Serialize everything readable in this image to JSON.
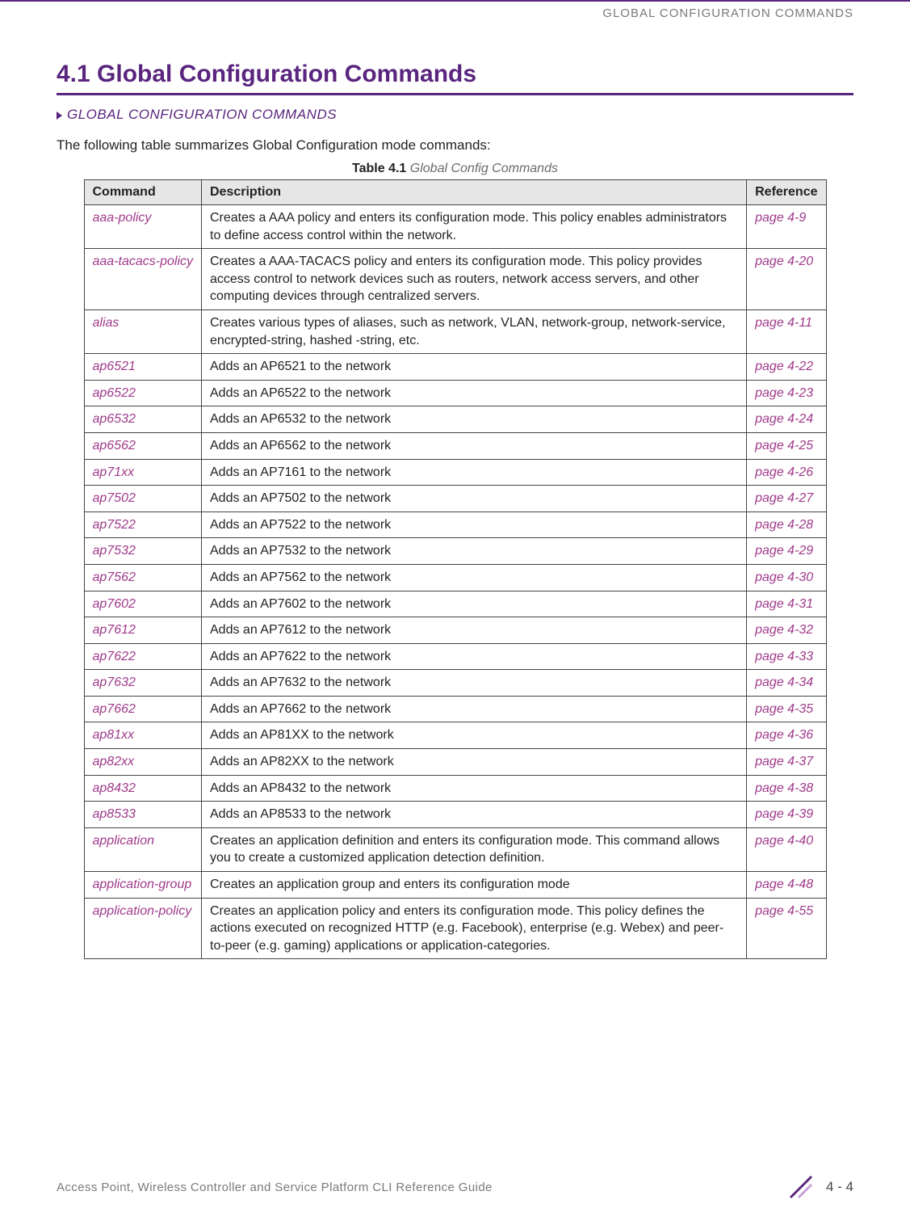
{
  "running_header": "GLOBAL CONFIGURATION COMMANDS",
  "section_title": "4.1 Global Configuration Commands",
  "breadcrumb": "GLOBAL CONFIGURATION COMMANDS",
  "intro": "The following table summarizes Global Configuration mode commands:",
  "table_caption_num": "Table 4.1",
  "table_caption_title": "Global Config Commands",
  "headers": {
    "command": "Command",
    "description": "Description",
    "reference": "Reference"
  },
  "rows": [
    {
      "command": "aaa-policy",
      "description": "Creates a AAA policy and enters its configuration mode. This policy enables administrators to define access control within the network.",
      "reference": "page 4-9"
    },
    {
      "command": "aaa-tacacs-policy",
      "description": "Creates a AAA-TACACS policy and enters its configuration mode. This policy provides access control to network devices such as routers, network access servers, and other computing devices through centralized servers.",
      "reference": "page 4-20"
    },
    {
      "command": "alias",
      "description": "Creates various types of aliases, such as network, VLAN, network-group, network-service, encrypted-string, hashed -string, etc.",
      "reference": "page 4-11"
    },
    {
      "command": "ap6521",
      "description": "Adds an AP6521 to the network",
      "reference": "page 4-22"
    },
    {
      "command": "ap6522",
      "description": "Adds an AP6522 to the network",
      "reference": "page 4-23"
    },
    {
      "command": "ap6532",
      "description": "Adds an AP6532 to the network",
      "reference": "page 4-24"
    },
    {
      "command": "ap6562",
      "description": "Adds an AP6562 to the network",
      "reference": "page 4-25"
    },
    {
      "command": "ap71xx",
      "description": "Adds an AP7161 to the network",
      "reference": "page 4-26"
    },
    {
      "command": "ap7502",
      "description": "Adds an AP7502 to the network",
      "reference": "page 4-27"
    },
    {
      "command": "ap7522",
      "description": "Adds an AP7522 to the network",
      "reference": "page 4-28"
    },
    {
      "command": "ap7532",
      "description": "Adds an AP7532 to the network",
      "reference": "page 4-29"
    },
    {
      "command": "ap7562",
      "description": "Adds an AP7562 to the network",
      "reference": "page 4-30"
    },
    {
      "command": "ap7602",
      "description": "Adds an AP7602 to the network",
      "reference": "page 4-31"
    },
    {
      "command": "ap7612",
      "description": "Adds an AP7612 to the network",
      "reference": "page 4-32"
    },
    {
      "command": "ap7622",
      "description": "Adds an AP7622 to the network",
      "reference": "page 4-33"
    },
    {
      "command": "ap7632",
      "description": "Adds an AP7632 to the network",
      "reference": "page 4-34"
    },
    {
      "command": "ap7662",
      "description": "Adds an AP7662 to the network",
      "reference": "page 4-35"
    },
    {
      "command": "ap81xx",
      "description": "Adds an AP81XX to the network",
      "reference": "page 4-36"
    },
    {
      "command": "ap82xx",
      "description": "Adds an AP82XX to the network",
      "reference": "page 4-37"
    },
    {
      "command": "ap8432",
      "description": "Adds an AP8432 to the network",
      "reference": "page 4-38"
    },
    {
      "command": "ap8533",
      "description": "Adds an AP8533 to the network",
      "reference": "page 4-39"
    },
    {
      "command": "application",
      "description": "Creates an application definition and enters its configuration mode. This command allows you to create a customized application detection definition.",
      "reference": "page 4-40"
    },
    {
      "command": "application-group",
      "description": "Creates an application group and enters its configuration mode",
      "reference": "page 4-48"
    },
    {
      "command": "application-policy",
      "description": "Creates an application policy and enters its configuration mode. This policy defines the actions executed on recognized HTTP (e.g. Facebook), enterprise (e.g. Webex) and peer-to-peer (e.g. gaming) applications or application-categories.",
      "reference": "page 4-55"
    }
  ],
  "footer": {
    "guide": "Access Point, Wireless Controller and Service Platform CLI Reference Guide",
    "page": "4 - 4"
  }
}
